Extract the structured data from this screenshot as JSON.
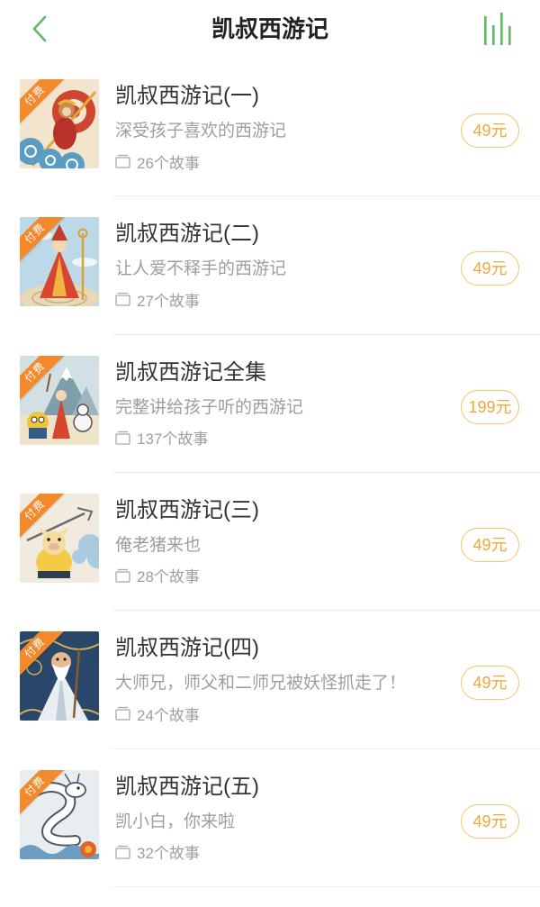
{
  "header": {
    "title": "凯叔西游记",
    "back_icon": "chevron-left-icon",
    "now_playing_icon": "audio-bars-icon"
  },
  "colors": {
    "accent_green": "#5dbb63",
    "price_text": "#eea83a",
    "price_border": "#f3c46c",
    "badge_orange": "#f2892b",
    "title_text": "#333333",
    "secondary_text": "#9e9e9e",
    "divider": "#ececec"
  },
  "album_list": {
    "count_icon": "folder-icon",
    "items": [
      {
        "badge": "付费",
        "title": "凯叔西游记(一)",
        "subtitle": "深受孩子喜欢的西游记",
        "story_count": "26个故事",
        "price": "49元"
      },
      {
        "badge": "付费",
        "title": "凯叔西游记(二)",
        "subtitle": "让人爱不释手的西游记",
        "story_count": "27个故事",
        "price": "49元"
      },
      {
        "badge": "付费",
        "title": "凯叔西游记全集",
        "subtitle": "完整讲给孩子听的西游记",
        "story_count": "137个故事",
        "price": "199元"
      },
      {
        "badge": "付费",
        "title": "凯叔西游记(三)",
        "subtitle": "俺老猪来也",
        "story_count": "28个故事",
        "price": "49元"
      },
      {
        "badge": "付费",
        "title": "凯叔西游记(四)",
        "subtitle": "大师兄，师父和二师兄被妖怪抓走了！",
        "story_count": "24个故事",
        "price": "49元"
      },
      {
        "badge": "付费",
        "title": "凯叔西游记(五)",
        "subtitle": "凯小白，你来啦",
        "story_count": "32个故事",
        "price": "49元"
      }
    ]
  }
}
